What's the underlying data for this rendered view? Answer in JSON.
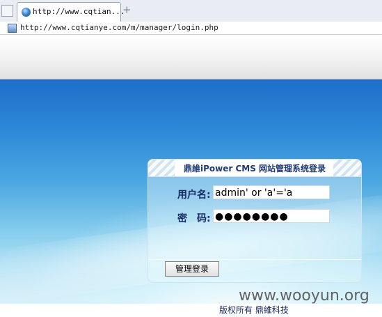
{
  "browser": {
    "tab_title": "http://www.cqtian...",
    "new_tab_symbol": "+",
    "url": "http://www.cqtianye.com/m/manager/login.php"
  },
  "login": {
    "title": "鼎維iPower CMS 网站管理系统登录",
    "username_label": "用户名:",
    "username_value": "admin' or 'a'='a",
    "password_label": "密　码:",
    "password_value": "●●●●●●●●",
    "submit_label": "管理登录"
  },
  "footer": {
    "copyright": "版权所有 鼎維科技"
  },
  "watermark": "www.wooyun.org",
  "colors": {
    "hero_top": "#1e6fc9",
    "hero_bottom": "#d7f1fa",
    "label_text": "#1a2b63"
  }
}
